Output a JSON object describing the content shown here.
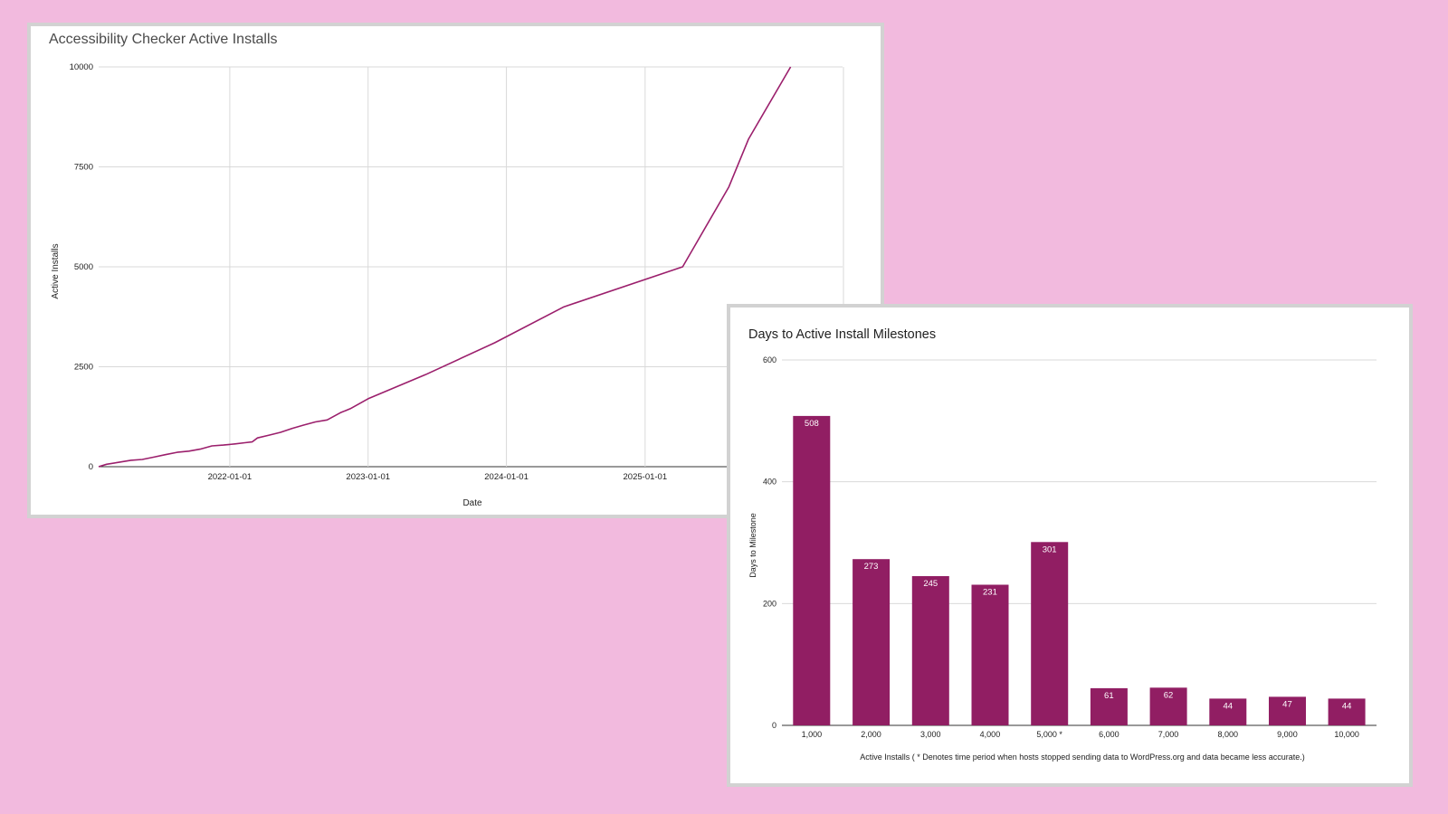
{
  "line_chart": {
    "chart_data": {
      "type": "line",
      "title": "Accessibility Checker Active Installs",
      "xlabel": "Date",
      "ylabel": "Active Installs",
      "ylim": [
        0,
        10000
      ],
      "yticks": [
        0,
        2500,
        5000,
        7500,
        10000
      ],
      "xticks": [
        "2022-01-01",
        "2023-01-01",
        "2024-01-01",
        "2025-01-01"
      ],
      "xlim": [
        "2021-01-20",
        "2026-06-06"
      ],
      "grid": true,
      "series": [
        {
          "color": "#9b1f6c",
          "points": [
            [
              "2021-01-20",
              0
            ],
            [
              "2021-02-10",
              60
            ],
            [
              "2021-03-15",
              110
            ],
            [
              "2021-04-15",
              160
            ],
            [
              "2021-05-15",
              180
            ],
            [
              "2021-06-15",
              240
            ],
            [
              "2021-07-15",
              300
            ],
            [
              "2021-08-15",
              360
            ],
            [
              "2021-09-15",
              390
            ],
            [
              "2021-10-15",
              440
            ],
            [
              "2021-11-15",
              520
            ],
            [
              "2021-12-15",
              540
            ],
            [
              "2022-01-15",
              570
            ],
            [
              "2022-02-10",
              600
            ],
            [
              "2022-03-01",
              620
            ],
            [
              "2022-03-15",
              720
            ],
            [
              "2022-04-15",
              790
            ],
            [
              "2022-05-15",
              860
            ],
            [
              "2022-06-15",
              960
            ],
            [
              "2022-07-15",
              1040
            ],
            [
              "2022-08-15",
              1120
            ],
            [
              "2022-09-15",
              1170
            ],
            [
              "2022-10-20",
              1350
            ],
            [
              "2022-11-15",
              1450
            ],
            [
              "2023-01-01",
              1700
            ],
            [
              "2023-06-01",
              2300
            ],
            [
              "2023-12-01",
              3100
            ],
            [
              "2024-06-01",
              4000
            ],
            [
              "2025-04-10",
              5000
            ],
            [
              "2025-08-10",
              7000
            ],
            [
              "2025-10-01",
              8200
            ],
            [
              "2026-01-20",
              10000
            ]
          ]
        }
      ]
    }
  },
  "bar_chart": {
    "chart_data": {
      "type": "bar",
      "title": "Days to Active Install Milestones",
      "xlabel": "Active Installs ( * Denotes time period when hosts stopped sending data to WordPress.org and data became less accurate.)",
      "ylabel": "Days to Milestone",
      "ylim": [
        0,
        600
      ],
      "yticks": [
        0,
        200,
        400,
        600
      ],
      "grid": true,
      "color": "#911e63",
      "categories": [
        "1,000",
        "2,000",
        "3,000",
        "4,000",
        "5,000 *",
        "6,000",
        "7,000",
        "8,000",
        "9,000",
        "10,000"
      ],
      "values": [
        508,
        273,
        245,
        231,
        301,
        61,
        62,
        44,
        47,
        44
      ],
      "data_labels": [
        "508",
        "273",
        "245",
        "231",
        "301",
        "61",
        "62",
        "44",
        "47",
        "44"
      ]
    }
  }
}
